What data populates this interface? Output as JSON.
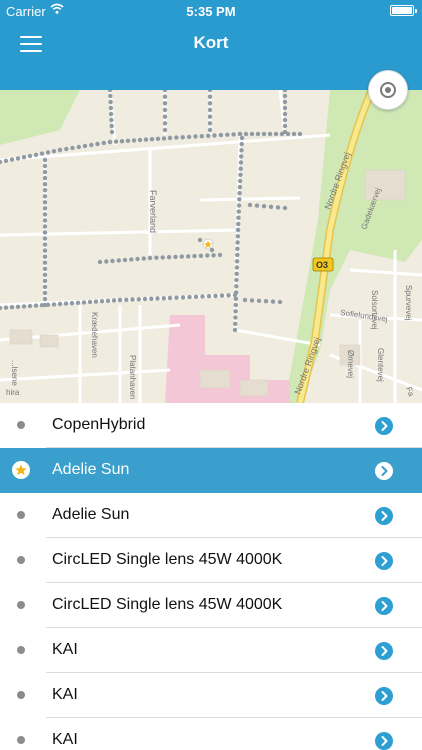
{
  "status_bar": {
    "carrier": "Carrier",
    "time": "5:35 PM"
  },
  "nav": {
    "title": "Kort"
  },
  "map": {
    "labels": {
      "farverland": "Farverland",
      "nordre_ringvej_top": "Nordre Ringvej",
      "nordre_ringvej_bottom": "Nordre Ringvej",
      "road_badge": "O3",
      "sofielundsvej": "Sofielundsvej",
      "solsortevej": "Solsortevej",
      "spurvevej": "Spurvevej",
      "omevej": "Ørnevej",
      "glentevej": "Glentevej",
      "platanhaven": "Platanhaven",
      "kraedehaven": "Krædehaven",
      "lensvej": "...lsene",
      "fa": "Fa",
      "hira": "hira",
      "gadekaer": "Gadekærvej"
    },
    "colors": {
      "base": "#f1ece0",
      "park": "#cfe8b4",
      "road": "#ffffff",
      "highway": "#f3e07a",
      "pink": "#f4c7d6",
      "dots": "#8f9aa3"
    }
  },
  "list": {
    "items": [
      {
        "label": "CopenHybrid",
        "selected": false,
        "starred": false
      },
      {
        "label": "Adelie Sun",
        "selected": true,
        "starred": true
      },
      {
        "label": "Adelie Sun",
        "selected": false,
        "starred": false
      },
      {
        "label": "CircLED Single lens 45W 4000K",
        "selected": false,
        "starred": false
      },
      {
        "label": "CircLED Single lens 45W 4000K",
        "selected": false,
        "starred": false
      },
      {
        "label": "KAI",
        "selected": false,
        "starred": false
      },
      {
        "label": "KAI",
        "selected": false,
        "starred": false
      },
      {
        "label": "KAI",
        "selected": false,
        "starred": false
      }
    ]
  },
  "colors": {
    "accent": "#2a9bcf",
    "selected_row": "#3a9fcc"
  }
}
